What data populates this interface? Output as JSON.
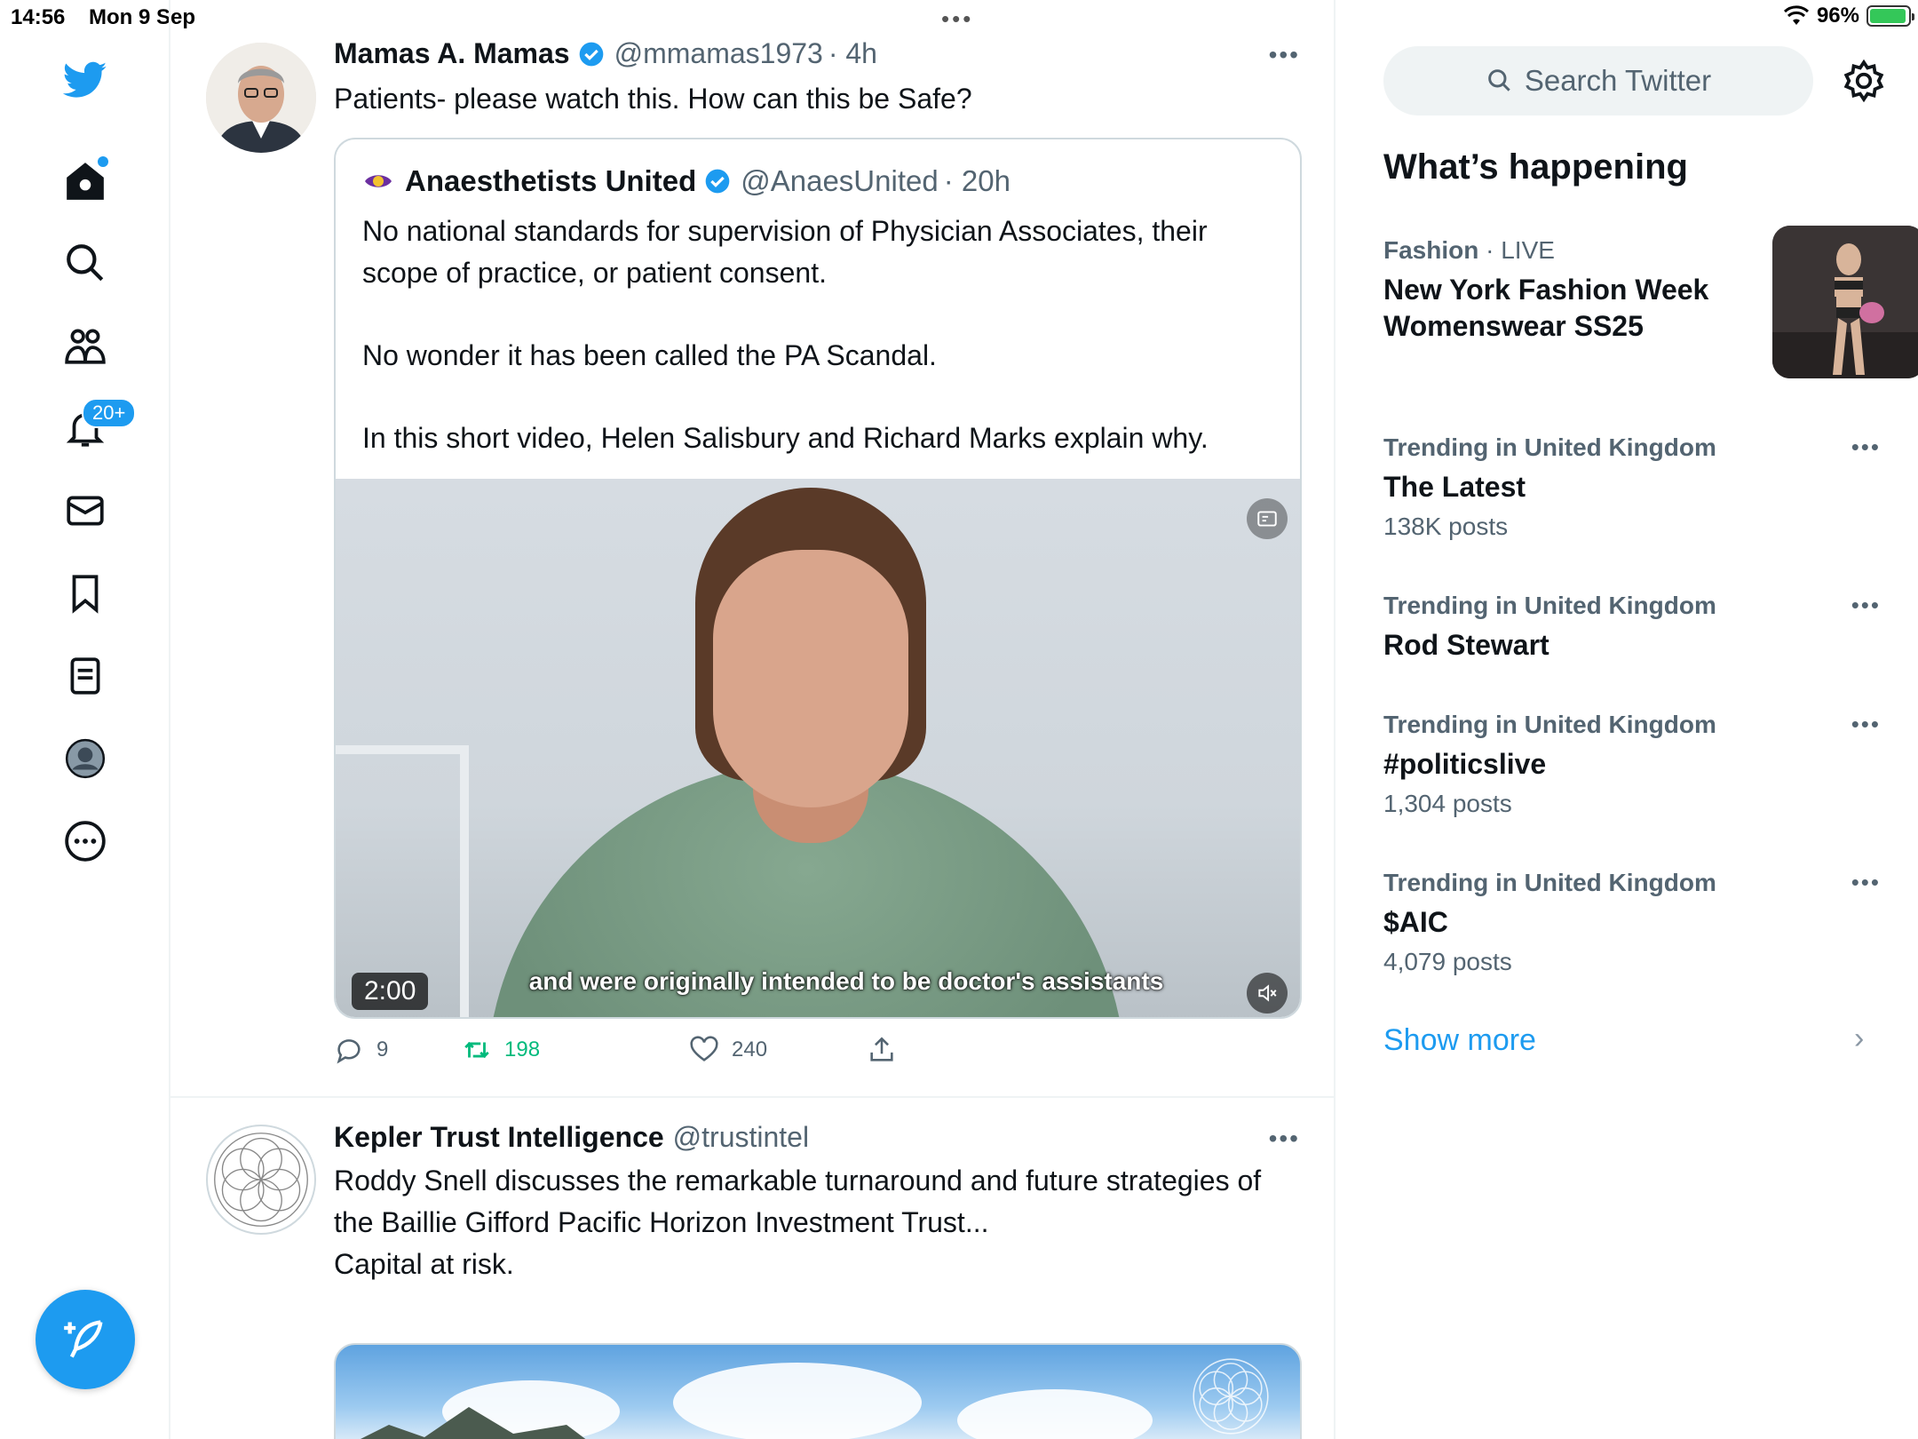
{
  "status_bar": {
    "time": "14:56",
    "date": "Mon 9 Sep",
    "battery": "96%",
    "battery_level": 0.96
  },
  "nav": {
    "notifications_badge": "20+",
    "accent": "#1d9bf0"
  },
  "tweets": [
    {
      "name": "Mamas A. Mamas",
      "handle": "@mmamas1973",
      "time": "· 4h",
      "text": "Patients- please watch this. How can this be Safe?",
      "quote": {
        "name": "Anaesthetists United",
        "handle": "@AnaesUnited",
        "time": "· 20h",
        "paragraphs": [
          "No national standards for supervision of Physician Associates, their scope of practice, or patient consent.",
          "No wonder it has been called the PA Scandal.",
          "In this short video, Helen Salisbury and Richard Marks explain why."
        ],
        "video": {
          "duration": "2:00",
          "caption": "and were originally intended to be doctor's assistants"
        }
      },
      "actions": {
        "replies": "9",
        "retweets": "198",
        "likes": "240"
      }
    },
    {
      "name": "Kepler Trust Intelligence",
      "handle": "@trustintel",
      "text": "Roddy Snell discusses the remarkable turnaround and future strategies of the Baillie Gifford Pacific Horizon Investment Trust...",
      "text2": "Capital at risk."
    }
  ],
  "sidebar": {
    "search_placeholder": "Search Twitter",
    "whats_happening": "What’s happening",
    "trends": [
      {
        "context": "Fashion",
        "live": "· LIVE",
        "name": "New York Fashion Week Womenswear SS25"
      },
      {
        "context": "Trending in United Kingdom",
        "name": "The Latest",
        "count": "138K posts"
      },
      {
        "context": "Trending in United Kingdom",
        "name": "Rod Stewart"
      },
      {
        "context": "Trending in United Kingdom",
        "name": "#politicslive",
        "count": "1,304 posts"
      },
      {
        "context": "Trending in United Kingdom",
        "name": "$AIC",
        "count": "4,079 posts"
      }
    ],
    "show_more": "Show more"
  }
}
